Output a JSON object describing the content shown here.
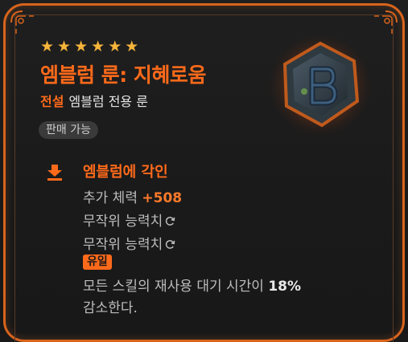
{
  "item": {
    "stars": [
      "★",
      "★",
      "★",
      "★",
      "★",
      "★"
    ],
    "name": "엠블럼 룬: 지혜로움",
    "grade": "전설",
    "type": "엠블럼 전용 룬",
    "sale_status": "판매 가능",
    "icon": "emblem-rune-gem-icon"
  },
  "engraving": {
    "icon": "download-arrow-icon",
    "title": "엠블럼에 각인",
    "stat_label": "추가 체력",
    "stat_value": "+508",
    "random_lines": [
      {
        "label": "무작위 능력치",
        "icon": "reroll-icon"
      },
      {
        "label": "무작위 능력치",
        "icon": "reroll-icon"
      }
    ],
    "unique_tag": "유일",
    "effect_prefix": "모든 스킬의 재사용 대기 시간이",
    "effect_value": "18%",
    "effect_suffix": "감소한다."
  },
  "colors": {
    "accent": "#ff6a1a",
    "star": "#f6b43a",
    "border": "#d8641d",
    "background": "#1a1a1a"
  }
}
